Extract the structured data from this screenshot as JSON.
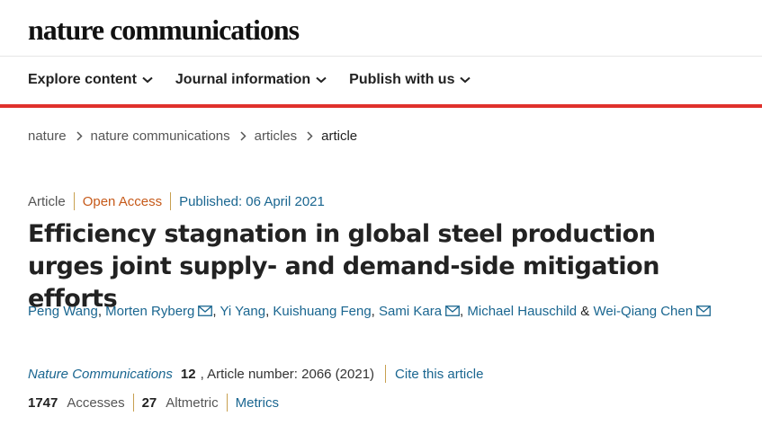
{
  "header": {
    "logo": "nature communications"
  },
  "nav": {
    "items": [
      {
        "label": "Explore content"
      },
      {
        "label": "Journal information"
      },
      {
        "label": "Publish with us"
      }
    ]
  },
  "breadcrumb": {
    "items": [
      "nature",
      "nature communications",
      "articles",
      "article"
    ]
  },
  "article": {
    "type": "Article",
    "access": "Open Access",
    "published": "Published: 06 April 2021",
    "title": "Efficiency stagnation in global steel production urges joint supply- and demand-side mitigation efforts",
    "authors": [
      {
        "name": "Peng Wang",
        "email": false
      },
      {
        "name": "Morten Ryberg",
        "email": true
      },
      {
        "name": "Yi Yang",
        "email": false
      },
      {
        "name": "Kuishuang Feng",
        "email": false
      },
      {
        "name": "Sami Kara",
        "email": true
      },
      {
        "name": "Michael Hauschild",
        "email": false
      },
      {
        "name": "Wei-Qiang Chen",
        "email": true
      }
    ],
    "journal": "Nature Communications",
    "volume": "12",
    "article_number": ", Article number: 2066 (2021)",
    "cite_label": "Cite this article"
  },
  "metrics": {
    "accesses_count": "1747",
    "accesses_label": "Accesses",
    "altmetric_count": "27",
    "altmetric_label": "Altmetric",
    "metrics_link": "Metrics"
  },
  "colors": {
    "accent_red": "#e0312c",
    "link_blue": "#1a6690",
    "open_access_orange": "#c65a1a"
  }
}
